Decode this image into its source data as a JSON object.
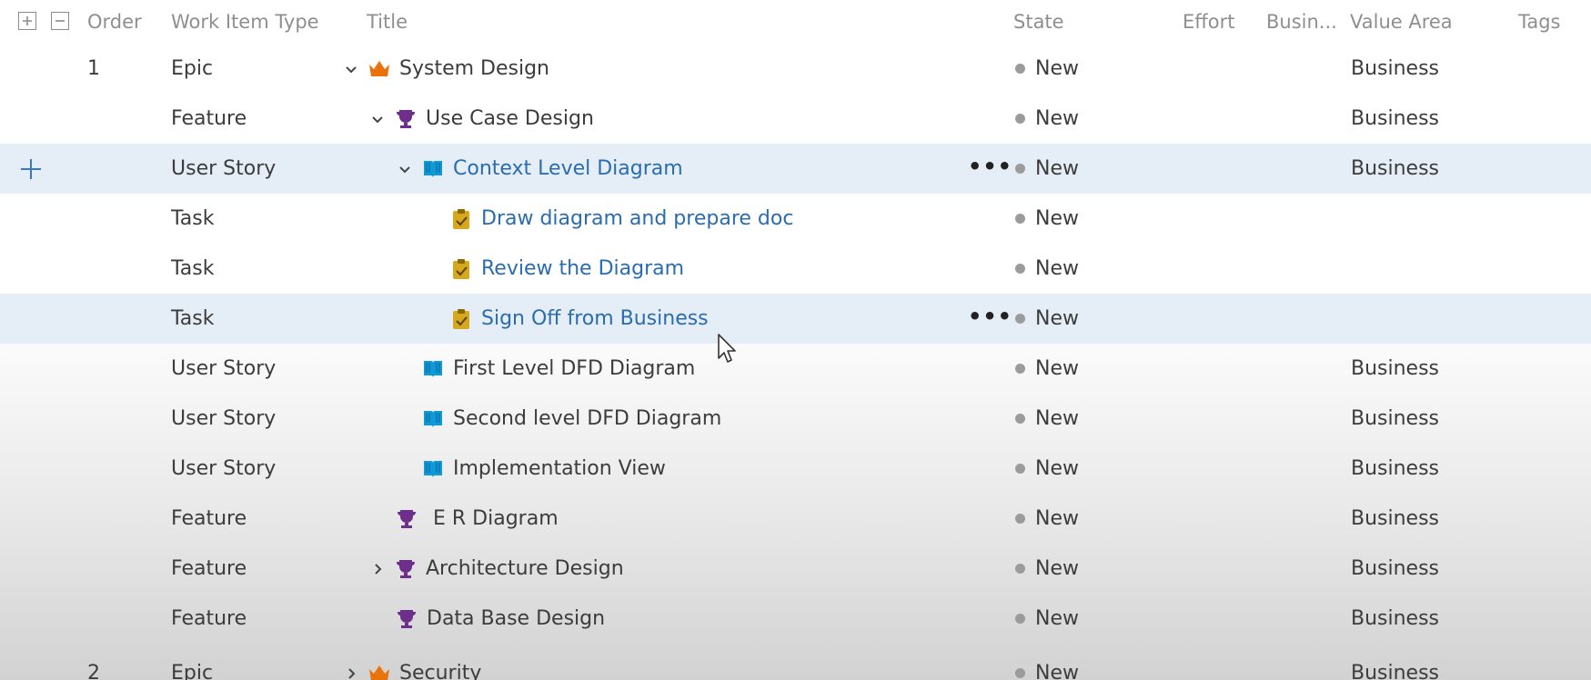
{
  "header": {
    "expand_icon": "plus-box-icon",
    "collapse_icon": "minus-box-icon",
    "order": "Order",
    "work_item_type": "Work Item Type",
    "title": "Title",
    "state": "State",
    "effort": "Effort",
    "business": "Busin...",
    "value_area": "Value Area",
    "tags": "Tags"
  },
  "colors": {
    "epic": "#e8730c",
    "feature": "#6d2e8c",
    "user_story": "#0f9ad7",
    "task": "#d6a81f",
    "link": "#2a6cb0",
    "state_new": "#9b9b9b",
    "highlight": "#e1ebf5"
  },
  "rows": [
    {
      "order": "1",
      "type": "Epic",
      "title": "System Design",
      "state": "New",
      "value_area": "Business",
      "icon": "crown-icon",
      "chevron": "down"
    },
    {
      "order": "",
      "type": "Feature",
      "title": "Use Case Design",
      "state": "New",
      "value_area": "Business",
      "icon": "trophy-icon",
      "chevron": "down"
    },
    {
      "order": "",
      "type": "User Story",
      "title": "Context Level Diagram",
      "state": "New",
      "value_area": "Business",
      "icon": "book-icon",
      "chevron": "down",
      "more": "•••",
      "add_icon": "add-icon"
    },
    {
      "order": "",
      "type": "Task",
      "title": "Draw diagram and prepare doc",
      "state": "New",
      "value_area": "",
      "icon": "clipboard-icon",
      "chevron": ""
    },
    {
      "order": "",
      "type": "Task",
      "title": "Review the Diagram",
      "state": "New",
      "value_area": "",
      "icon": "clipboard-icon",
      "chevron": ""
    },
    {
      "order": "",
      "type": "Task",
      "title": "Sign Off from Business",
      "state": "New",
      "value_area": "",
      "icon": "clipboard-icon",
      "chevron": "",
      "more": "•••"
    },
    {
      "order": "",
      "type": "User Story",
      "title": "First Level DFD Diagram",
      "state": "New",
      "value_area": "Business",
      "icon": "book-icon",
      "chevron": ""
    },
    {
      "order": "",
      "type": "User Story",
      "title": "Second level DFD Diagram",
      "state": "New",
      "value_area": "Business",
      "icon": "book-icon",
      "chevron": ""
    },
    {
      "order": "",
      "type": "User Story",
      "title": "Implementation View",
      "state": "New",
      "value_area": "Business",
      "icon": "book-icon",
      "chevron": ""
    },
    {
      "order": "",
      "type": "Feature",
      "title": "E R Diagram",
      "state": "New",
      "value_area": "Business",
      "icon": "trophy-icon",
      "chevron": ""
    },
    {
      "order": "",
      "type": "Feature",
      "title": "Architecture Design",
      "state": "New",
      "value_area": "Business",
      "icon": "trophy-icon",
      "chevron": "right"
    },
    {
      "order": "",
      "type": "Feature",
      "title": "Data Base Design",
      "state": "New",
      "value_area": "Business",
      "icon": "trophy-icon",
      "chevron": ""
    },
    {
      "order": "2",
      "type": "Epic",
      "title": "Security",
      "state": "New",
      "value_area": "Business",
      "icon": "crown-icon",
      "chevron": "right"
    }
  ]
}
